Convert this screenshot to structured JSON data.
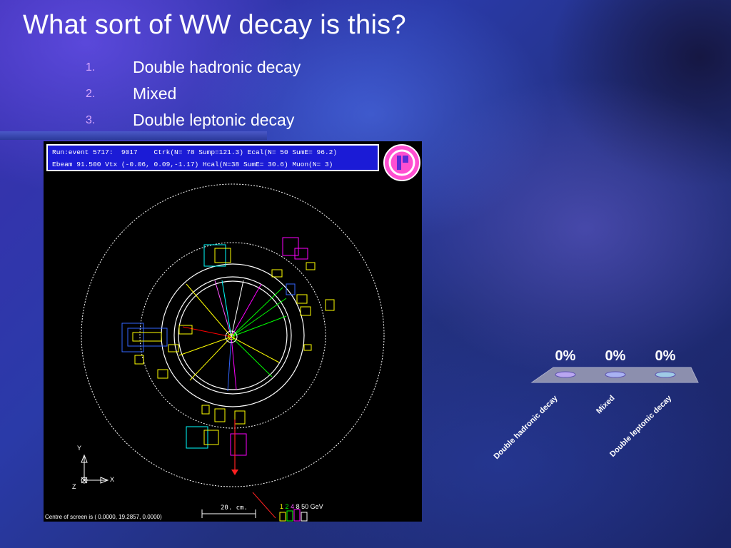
{
  "slide": {
    "title": "What sort of WW decay is this?",
    "options": [
      {
        "num": "1.",
        "label": "Double hadronic decay"
      },
      {
        "num": "2.",
        "label": "Mixed"
      },
      {
        "num": "3.",
        "label": "Double leptonic decay"
      }
    ]
  },
  "event_display": {
    "info_line1": "Run:event 5717:  9017    Ctrk(N= 78 Sump=121.3) Ecal(N= 50 SumE= 96.2)",
    "info_line2": "Ebeam 91.500 Vtx (-0.06, 0.09,-1.17) Hcal(N=38 SumE= 30.6) Muon(N= 3)",
    "axis_y": "Y",
    "axis_x": "X",
    "axis_z": "Z",
    "scale_label": "20. cm.",
    "energy_legend": {
      "v1": "1",
      "v2": "2",
      "v3": "4",
      "v4": "8",
      "v5": "50 GeV"
    },
    "footer": "Centre of screen is (    0.0000,  19.2857,    0.0000)",
    "colors": {
      "info_bg": "#1b1bd6",
      "logo": "#ff4fd1"
    }
  },
  "poll": {
    "chart_data": {
      "type": "bar",
      "categories": [
        "Double hadronic decay",
        "Mixed",
        "Double leptonic decay"
      ],
      "values": [
        0,
        0,
        0
      ],
      "value_labels": [
        "0%",
        "0%",
        "0%"
      ],
      "colors": [
        "#b9a6f0",
        "#a9b2f2",
        "#9fcbe6"
      ]
    }
  }
}
